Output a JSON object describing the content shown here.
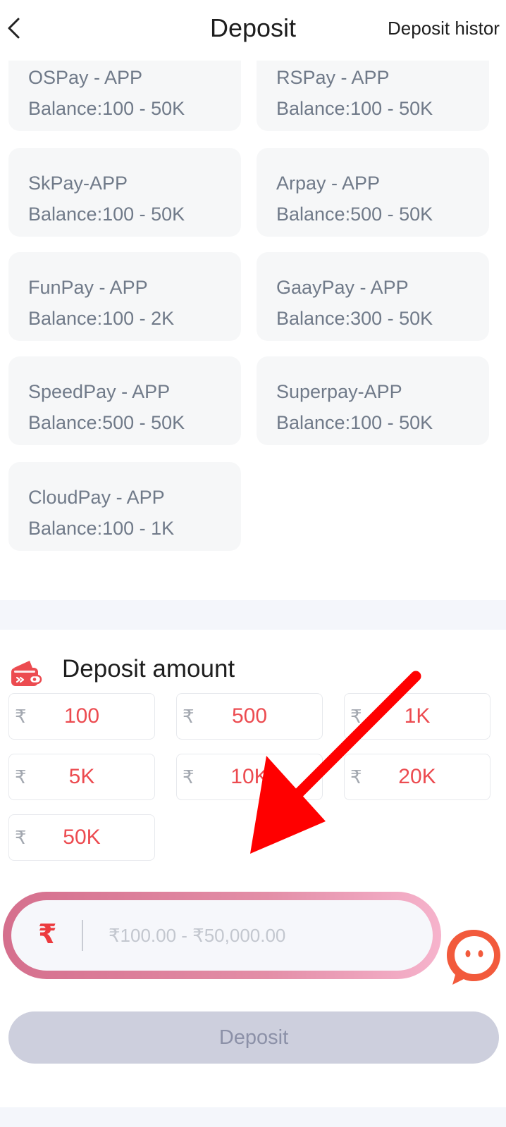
{
  "header": {
    "title": "Deposit",
    "history_link": "Deposit histor"
  },
  "channels": [
    {
      "name": "OSPay - APP",
      "range": "Balance:100 - 50K"
    },
    {
      "name": "RSPay - APP",
      "range": "Balance:100 - 50K"
    },
    {
      "name": "SkPay-APP",
      "range": "Balance:100 - 50K"
    },
    {
      "name": "Arpay - APP",
      "range": "Balance:500 - 50K"
    },
    {
      "name": "FunPay - APP",
      "range": "Balance:100 - 2K"
    },
    {
      "name": "GaayPay - APP",
      "range": "Balance:300 - 50K"
    },
    {
      "name": "SpeedPay - APP",
      "range": "Balance:500 - 50K"
    },
    {
      "name": "Superpay-APP",
      "range": "Balance:100 - 50K"
    },
    {
      "name": "CloudPay - APP",
      "range": "Balance:100 - 1K"
    }
  ],
  "amount_section": {
    "title": "Deposit amount",
    "currency_symbol": "₹",
    "chips": [
      "100",
      "500",
      "1K",
      "5K",
      "10K",
      "20K",
      "50K"
    ],
    "input": {
      "placeholder": "₹100.00 - ₹50,000.00",
      "value": ""
    }
  },
  "deposit_button": {
    "label": "Deposit"
  },
  "icons": {
    "back": "chevron-left-icon",
    "wallet": "wallet-icon",
    "chat": "chat-bubble-icon",
    "arrow": "red-arrow-annotation"
  },
  "colors": {
    "accent_red": "#ec4b50",
    "input_ring": "#e38ea7",
    "button_disabled": "#cdcfdd",
    "card_bg": "#f6f7f8"
  }
}
